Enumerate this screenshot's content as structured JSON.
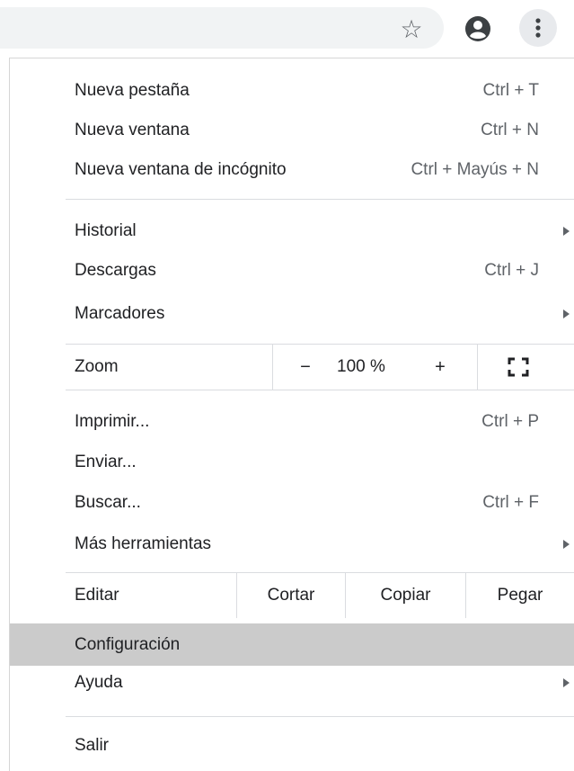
{
  "toolbar": {
    "star_icon": "star-outline",
    "avatar_icon": "account-circle",
    "menu_icon": "more-vertical"
  },
  "menu": {
    "new_tab": {
      "label": "Nueva pestaña",
      "shortcut": "Ctrl + T"
    },
    "new_window": {
      "label": "Nueva ventana",
      "shortcut": "Ctrl + N"
    },
    "incognito": {
      "label": "Nueva ventana de incógnito",
      "shortcut": "Ctrl + Mayús + N"
    },
    "history": {
      "label": "Historial"
    },
    "downloads": {
      "label": "Descargas",
      "shortcut": "Ctrl + J"
    },
    "bookmarks": {
      "label": "Marcadores"
    },
    "zoom": {
      "label": "Zoom",
      "minus": "−",
      "value": "100 %",
      "plus": "+",
      "fullscreen_icon": "fullscreen"
    },
    "print": {
      "label": "Imprimir...",
      "shortcut": "Ctrl + P"
    },
    "cast": {
      "label": "Enviar..."
    },
    "find": {
      "label": "Buscar...",
      "shortcut": "Ctrl + F"
    },
    "more_tools": {
      "label": "Más herramientas"
    },
    "edit": {
      "label": "Editar",
      "cut": "Cortar",
      "copy": "Copiar",
      "paste": "Pegar"
    },
    "settings": {
      "label": "Configuración"
    },
    "help": {
      "label": "Ayuda"
    },
    "exit": {
      "label": "Salir"
    }
  },
  "colors": {
    "highlight": "#cbcbcb",
    "separator": "#dadce0",
    "text": "#202124",
    "secondary_text": "#5f6368"
  }
}
